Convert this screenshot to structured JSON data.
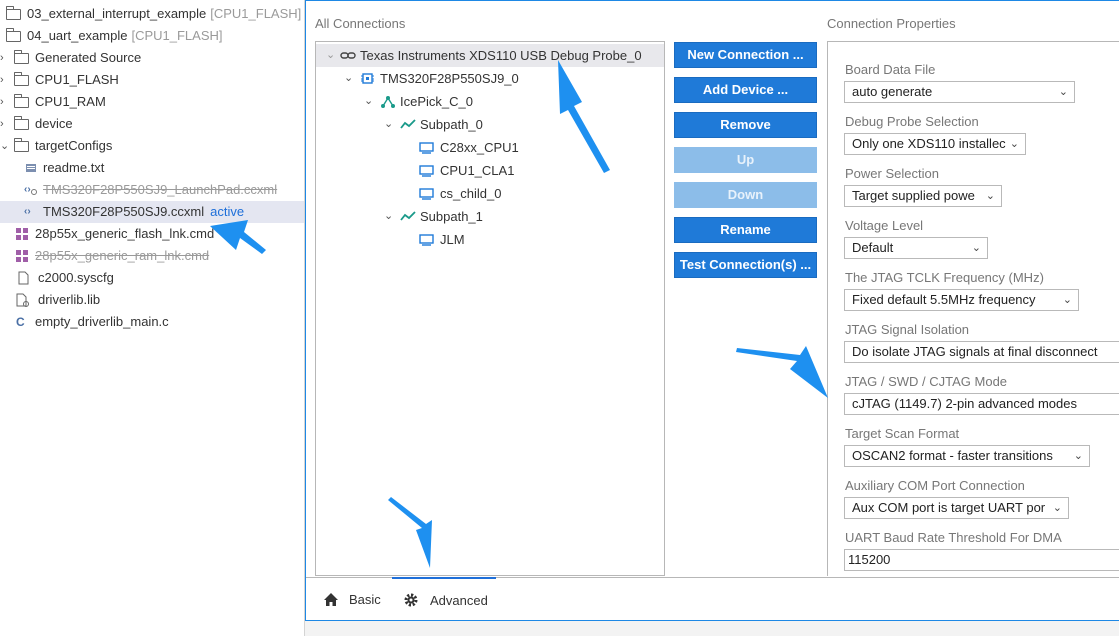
{
  "explorer": {
    "items": [
      {
        "label": "03_external_interrupt_example",
        "deco": "[CPU1_FLASH]"
      },
      {
        "label": "04_uart_example",
        "deco": "[CPU1_FLASH]"
      },
      {
        "label": "Generated Source"
      },
      {
        "label": "CPU1_FLASH"
      },
      {
        "label": "CPU1_RAM"
      },
      {
        "label": "device"
      },
      {
        "label": "targetConfigs"
      },
      {
        "label": "readme.txt"
      },
      {
        "label": "TMS320F28P550SJ9_LaunchPad.ccxml"
      },
      {
        "label": "TMS320F28P550SJ9.ccxml",
        "status": "active"
      },
      {
        "label": "28p55x_generic_flash_lnk.cmd"
      },
      {
        "label": "28p55x_generic_ram_lnk.cmd"
      },
      {
        "label": "c2000.syscfg"
      },
      {
        "label": "driverlib.lib"
      },
      {
        "label": "empty_driverlib_main.c"
      }
    ]
  },
  "connections": {
    "title": "All Connections",
    "tree": [
      {
        "label": "Texas Instruments XDS110 USB Debug Probe_0"
      },
      {
        "label": "TMS320F28P550SJ9_0"
      },
      {
        "label": "IcePick_C_0"
      },
      {
        "label": "Subpath_0"
      },
      {
        "label": "C28xx_CPU1"
      },
      {
        "label": "CPU1_CLA1"
      },
      {
        "label": "cs_child_0"
      },
      {
        "label": "Subpath_1"
      },
      {
        "label": "JLM"
      }
    ]
  },
  "buttons": {
    "new_connection": "New Connection ...",
    "add_device": "Add Device ...",
    "remove": "Remove",
    "up": "Up",
    "down": "Down",
    "rename": "Rename",
    "test_connection": "Test Connection(s) ..."
  },
  "properties": {
    "title": "Connection Properties",
    "fields": [
      {
        "label": "Board Data File",
        "value": "auto generate"
      },
      {
        "label": "Debug Probe Selection",
        "value": "Only one XDS110 installec"
      },
      {
        "label": "Power Selection",
        "value": "Target supplied powe"
      },
      {
        "label": "Voltage Level",
        "value": "Default"
      },
      {
        "label": "The JTAG TCLK Frequency (MHz)",
        "value": "Fixed default 5.5MHz frequency"
      },
      {
        "label": "JTAG Signal Isolation",
        "value": "Do isolate JTAG signals at final disconnect"
      },
      {
        "label": "JTAG / SWD / CJTAG Mode",
        "value": "cJTAG (1149.7) 2-pin advanced modes"
      },
      {
        "label": "Target Scan Format",
        "value": "OSCAN2 format - faster transitions"
      },
      {
        "label": "Auxiliary COM Port Connection",
        "value": "Aux COM port is target UART por"
      },
      {
        "label": "UART Baud Rate Threshold For DMA",
        "value": "115200"
      }
    ]
  },
  "tabs": {
    "basic": "Basic",
    "advanced": "Advanced"
  },
  "colors": {
    "accent": "#1f7ad8",
    "arrow": "#1e90f0",
    "active_text": "#1e6fd9"
  }
}
